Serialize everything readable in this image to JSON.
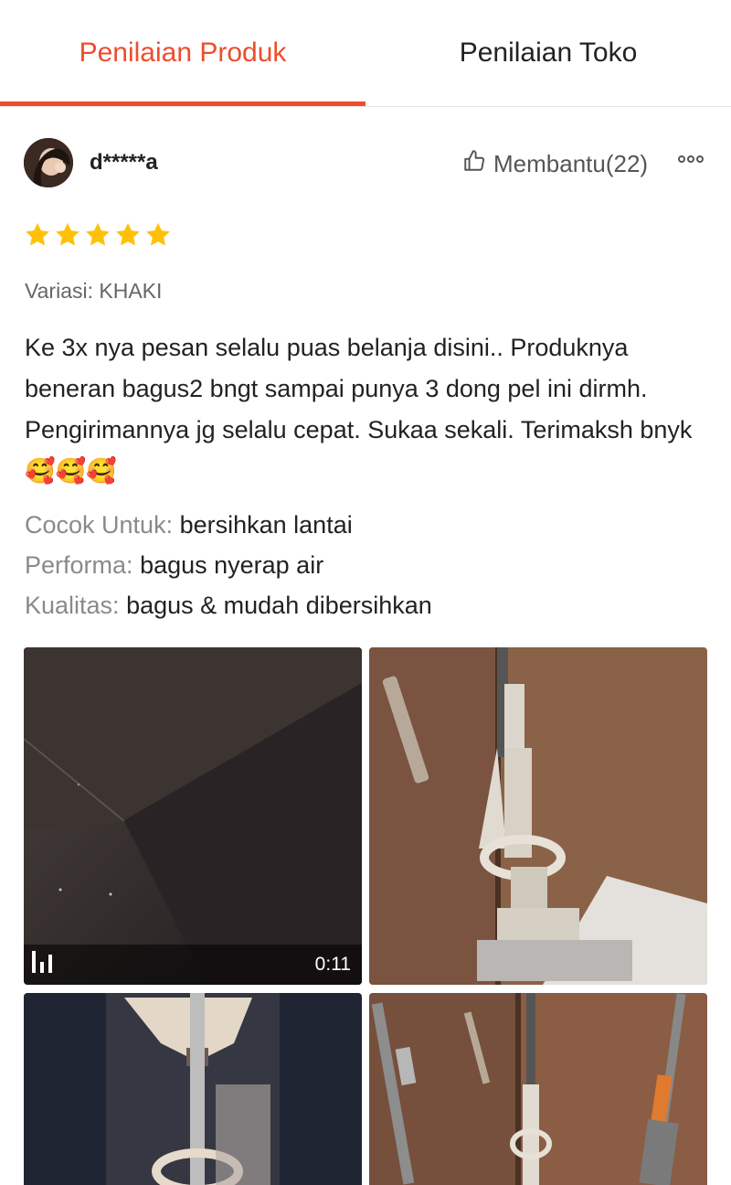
{
  "tabs": [
    {
      "label": "Penilaian Produk",
      "active": true
    },
    {
      "label": "Penilaian Toko",
      "active": false
    }
  ],
  "accent_color": "#ee4d2d",
  "review": {
    "username": "d*****a",
    "helpful_label": "Membantu(22)",
    "rating": 5,
    "star_color": "#ffc107",
    "variation": "Variasi: KHAKI",
    "text": "Ke 3x nya pesan selalu puas belanja disini.. Produknya beneran bagus2 bngt sampai punya 3 dong pel ini dirmh. Pengirimannya jg selalu cepat. Sukaa sekali. Terimaksh bnyk",
    "emoji": "🥰🥰🥰",
    "attributes": [
      {
        "label": "Cocok Untuk:",
        "value": "bersihkan lantai"
      },
      {
        "label": "Performa:",
        "value": "bagus nyerap air"
      },
      {
        "label": "Kualitas:",
        "value": "bagus & mudah dibersihkan"
      }
    ],
    "video_duration": "0:11"
  },
  "icons": [
    "thumbs-up-icon",
    "more-options-icon",
    "star-icon",
    "video-icon"
  ]
}
